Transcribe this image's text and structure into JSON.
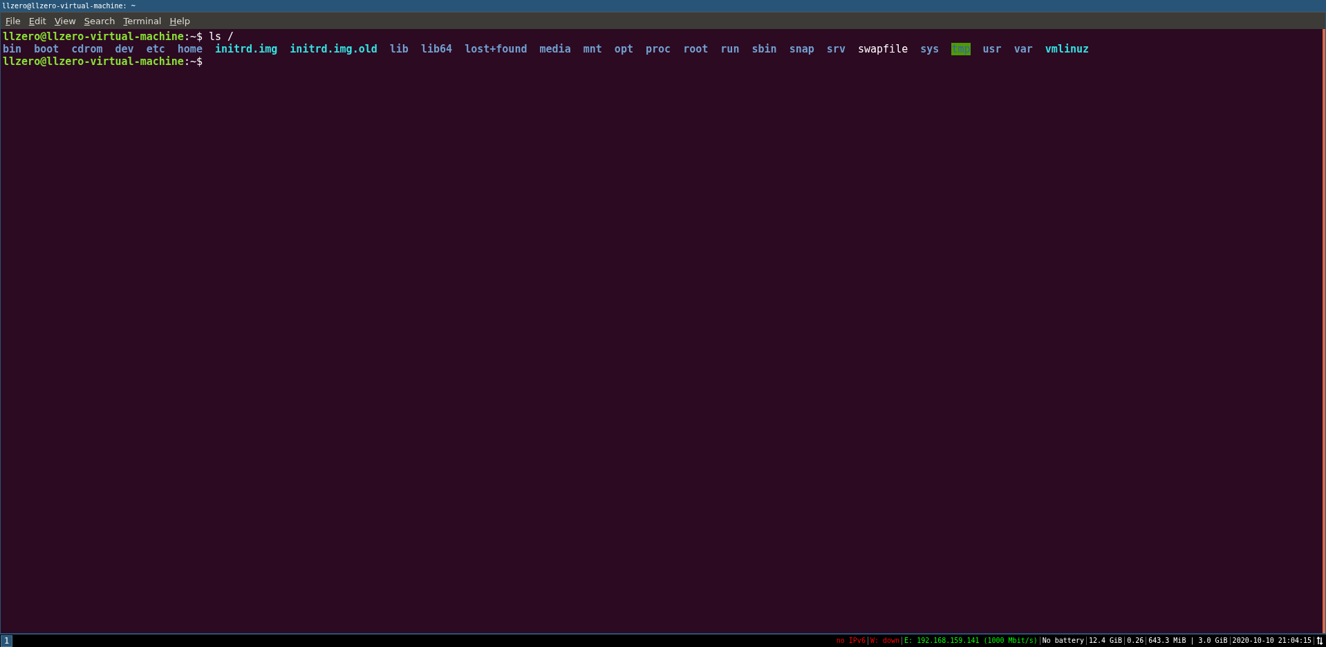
{
  "window": {
    "title": "llzero@llzero-virtual-machine: ~"
  },
  "menu": [
    "File",
    "Edit",
    "View",
    "Search",
    "Terminal",
    "Help"
  ],
  "terminal": {
    "lines": [
      {
        "kind": "command",
        "user_host": "llzero@llzero-virtual-machine",
        "path": ":~$",
        "command": " ls /"
      },
      {
        "kind": "listing",
        "entries": [
          {
            "name": "bin",
            "kind": "dir"
          },
          {
            "name": "boot",
            "kind": "dir"
          },
          {
            "name": "cdrom",
            "kind": "dir"
          },
          {
            "name": "dev",
            "kind": "dir"
          },
          {
            "name": "etc",
            "kind": "dir"
          },
          {
            "name": "home",
            "kind": "dir"
          },
          {
            "name": "initrd.img",
            "kind": "link"
          },
          {
            "name": "initrd.img.old",
            "kind": "link"
          },
          {
            "name": "lib",
            "kind": "dir"
          },
          {
            "name": "lib64",
            "kind": "dir"
          },
          {
            "name": "lost+found",
            "kind": "dir"
          },
          {
            "name": "media",
            "kind": "dir"
          },
          {
            "name": "mnt",
            "kind": "dir"
          },
          {
            "name": "opt",
            "kind": "dir"
          },
          {
            "name": "proc",
            "kind": "dir"
          },
          {
            "name": "root",
            "kind": "dir"
          },
          {
            "name": "run",
            "kind": "dir"
          },
          {
            "name": "sbin",
            "kind": "dir"
          },
          {
            "name": "snap",
            "kind": "dir"
          },
          {
            "name": "srv",
            "kind": "dir"
          },
          {
            "name": "swapfile",
            "kind": "file"
          },
          {
            "name": "sys",
            "kind": "dir"
          },
          {
            "name": "tmp",
            "kind": "sticky"
          },
          {
            "name": "usr",
            "kind": "dir"
          },
          {
            "name": "var",
            "kind": "dir"
          },
          {
            "name": "vmlinuz",
            "kind": "link"
          }
        ]
      },
      {
        "kind": "command",
        "user_host": "llzero@llzero-virtual-machine",
        "path": ":~$"
      }
    ]
  },
  "taskbar": {
    "workspaces": [
      {
        "label": "1",
        "selected": true
      }
    ],
    "status": [
      {
        "text": "no IPv6",
        "color": "#ff0000"
      },
      {
        "text": "W: down",
        "color": "#ff0000"
      },
      {
        "text": "E: 192.168.159.141 (1000 Mbit/s)",
        "color": "#00ff00"
      },
      {
        "text": "No battery",
        "color": "#ffffff"
      },
      {
        "text": "12.4 GiB",
        "color": "#ffffff"
      },
      {
        "text": "0.26",
        "color": "#ffffff"
      },
      {
        "text": "643.3 MiB | 3.0 GiB",
        "color": "#ffffff"
      },
      {
        "text": "2020-10-10 21:04:15",
        "color": "#ffffff"
      }
    ]
  }
}
